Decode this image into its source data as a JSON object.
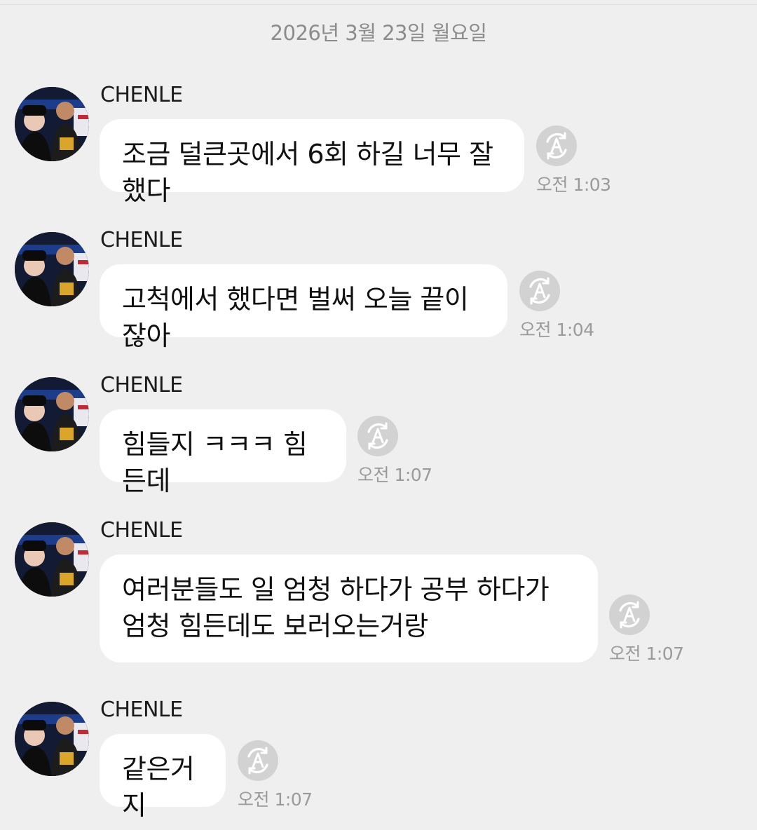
{
  "chat": {
    "date_separator": "2026년 3월 23일 월요일"
  },
  "colors": {
    "background": "#efefef",
    "bubble": "#ffffff",
    "translate_button": "#d2d2d2",
    "muted_text": "#9a9a9a"
  },
  "icons": {
    "translate": "translate-icon",
    "avatar": "profile-photo"
  },
  "messages": [
    {
      "sender": "CHENLE",
      "text": "조금 덜큰곳에서 6회 하길 너무 잘했다",
      "time": "오전 1:03"
    },
    {
      "sender": "CHENLE",
      "text": "고척에서 했다면 벌써 오늘 끝이잖아",
      "time": "오전 1:04"
    },
    {
      "sender": "CHENLE",
      "text": "힘들지 ㅋㅋㅋ 힘든데",
      "time": "오전 1:07"
    },
    {
      "sender": "CHENLE",
      "text": "여러분들도 일 엄청 하다가 공부 하다가 엄청 힘든데도 보러오는거랑",
      "time": "오전 1:07"
    },
    {
      "sender": "CHENLE",
      "text": "같은거지",
      "time": "오전 1:07"
    }
  ]
}
